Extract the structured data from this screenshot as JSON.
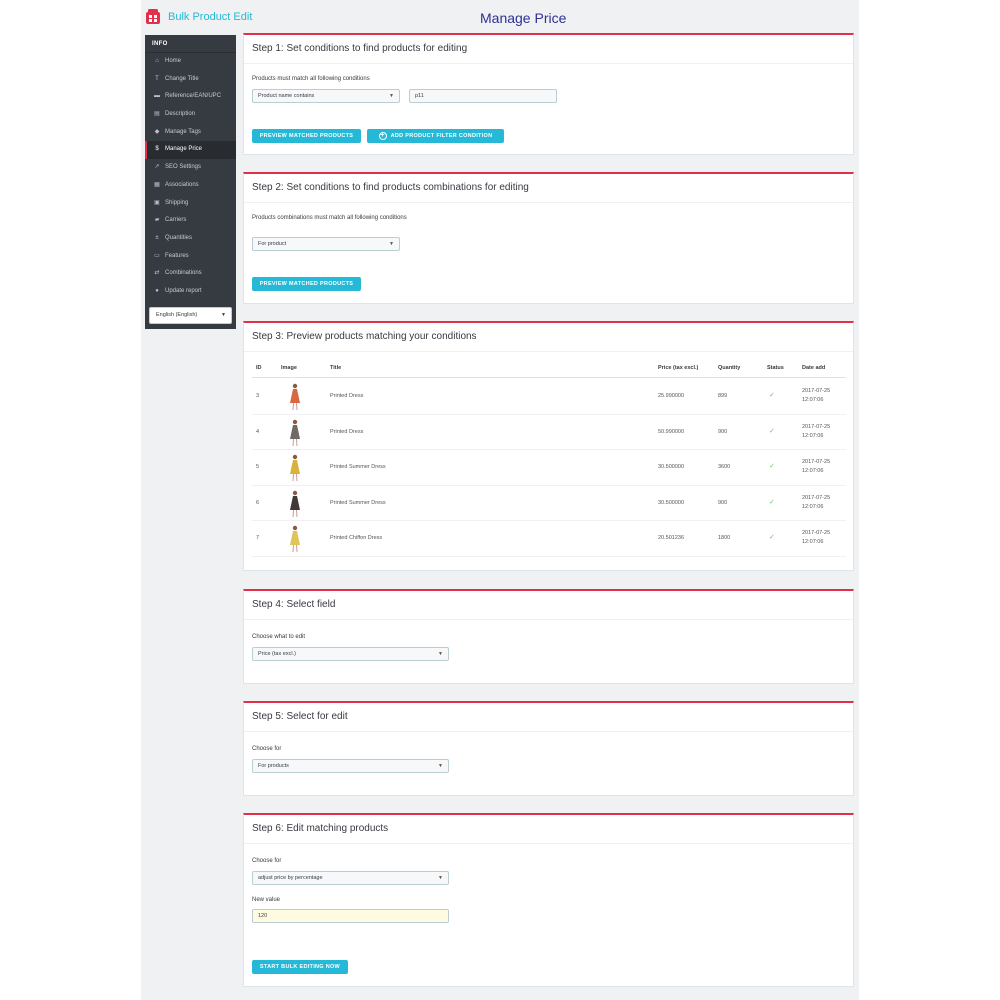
{
  "header": {
    "brand": "Bulk Product Edit",
    "title": "Manage Price"
  },
  "sidebar": {
    "heading": "INFO",
    "items": [
      {
        "label": "Home",
        "icon": "home-icon",
        "glyph": "⌂"
      },
      {
        "label": "Change Title",
        "icon": "text-icon",
        "glyph": "T"
      },
      {
        "label": "Reference/EAN/UPC",
        "icon": "barcode-icon",
        "glyph": "▬"
      },
      {
        "label": "Description",
        "icon": "document-icon",
        "glyph": "▤"
      },
      {
        "label": "Manage Tags",
        "icon": "tag-icon",
        "glyph": "◆"
      },
      {
        "label": "Manage Price",
        "icon": "dollar-icon",
        "glyph": "$"
      },
      {
        "label": "SEO Settings",
        "icon": "trend-icon",
        "glyph": "↗"
      },
      {
        "label": "Associations",
        "icon": "grid-icon",
        "glyph": "▦"
      },
      {
        "label": "Shipping",
        "icon": "box-icon",
        "glyph": "▣"
      },
      {
        "label": "Carriers",
        "icon": "truck-icon",
        "glyph": "▰"
      },
      {
        "label": "Quantities",
        "icon": "plus-minus-icon",
        "glyph": "±"
      },
      {
        "label": "Features",
        "icon": "card-icon",
        "glyph": "▭"
      },
      {
        "label": "Combinations",
        "icon": "combination-icon",
        "glyph": "⇄"
      },
      {
        "label": "Update report",
        "icon": "info-icon",
        "glyph": "●"
      }
    ],
    "active_index": 5,
    "language": "English (English)"
  },
  "step1": {
    "title": "Step 1: Set conditions to find products for editing",
    "hint": "Products must match all following conditions",
    "condition": "Product name contains",
    "value": "p11",
    "preview_button": "PREVIEW MATCHED PRODUCTS",
    "add_filter_button": "ADD PRODUCT FILTER CONDITION"
  },
  "step2": {
    "title": "Step 2: Set conditions to find products combinations for editing",
    "hint": "Products combinations must match all following conditions",
    "condition": "For product",
    "preview_button": "PREVIEW MATCHED PRODUCTS"
  },
  "step3": {
    "title": "Step 3: Preview products matching your conditions",
    "columns": [
      "ID",
      "Image",
      "Title",
      "Price (tax excl.)",
      "Quantity",
      "Status",
      "Date add"
    ],
    "rows": [
      {
        "id": "3",
        "title": "Printed Dress",
        "price": "25.990000",
        "quantity": "899",
        "date": "2017-07-25",
        "time": "12:07:06",
        "dress_color": "#d9673f"
      },
      {
        "id": "4",
        "title": "Printed Dress",
        "price": "50.990000",
        "quantity": "900",
        "date": "2017-07-25",
        "time": "12:07:06",
        "dress_color": "#6e6a66"
      },
      {
        "id": "5",
        "title": "Printed Summer Dress",
        "price": "30.500000",
        "quantity": "3600",
        "date": "2017-07-25",
        "time": "12:07:06",
        "dress_color": "#d9b23c"
      },
      {
        "id": "6",
        "title": "Printed Summer Dress",
        "price": "30.500000",
        "quantity": "900",
        "date": "2017-07-25",
        "time": "12:07:06",
        "dress_color": "#3f3a36"
      },
      {
        "id": "7",
        "title": "Printed Chiffon Dress",
        "price": "20.501236",
        "quantity": "1800",
        "date": "2017-07-25",
        "time": "12:07:06",
        "dress_color": "#e0c45a"
      }
    ]
  },
  "step4": {
    "title": "Step 4: Select field",
    "hint": "Choose what to edit",
    "field": "Price (tax excl.)"
  },
  "step5": {
    "title": "Step 5: Select for edit",
    "hint": "Choose for",
    "target": "For products"
  },
  "step6": {
    "title": "Step 6: Edit matching products",
    "hint": "Choose for",
    "mode": "adjust price by percentage",
    "value_label": "New value",
    "value": "120",
    "start_button": "START BULK EDITING NOW"
  },
  "colors": {
    "accent": "#25b9d7",
    "panel_top": "#e2304a",
    "sidebar": "#363a41",
    "title": "#2e3192"
  }
}
